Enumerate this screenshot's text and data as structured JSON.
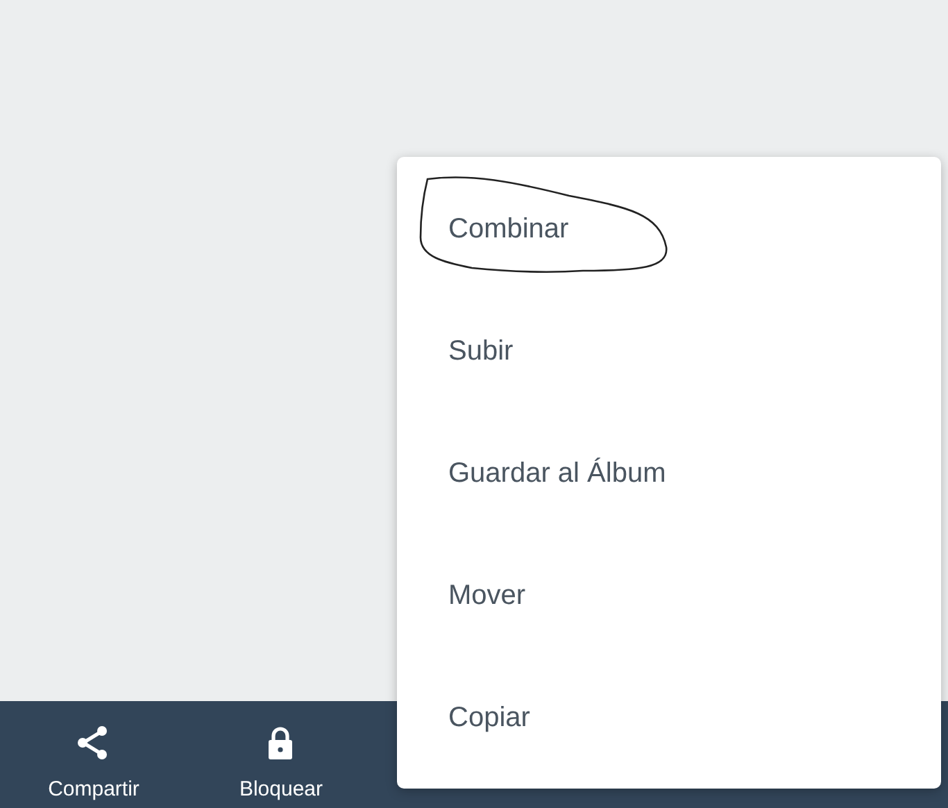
{
  "bottom_bar": {
    "items": [
      {
        "label": "Compartir",
        "kind": "share"
      },
      {
        "label": "Bloquear",
        "kind": "lock"
      }
    ]
  },
  "menu": {
    "items": [
      {
        "label": "Combinar",
        "circled": true
      },
      {
        "label": "Subir",
        "circled": false
      },
      {
        "label": "Guardar al Álbum",
        "circled": false
      },
      {
        "label": "Mover",
        "circled": false
      },
      {
        "label": "Copiar",
        "circled": false
      }
    ]
  }
}
